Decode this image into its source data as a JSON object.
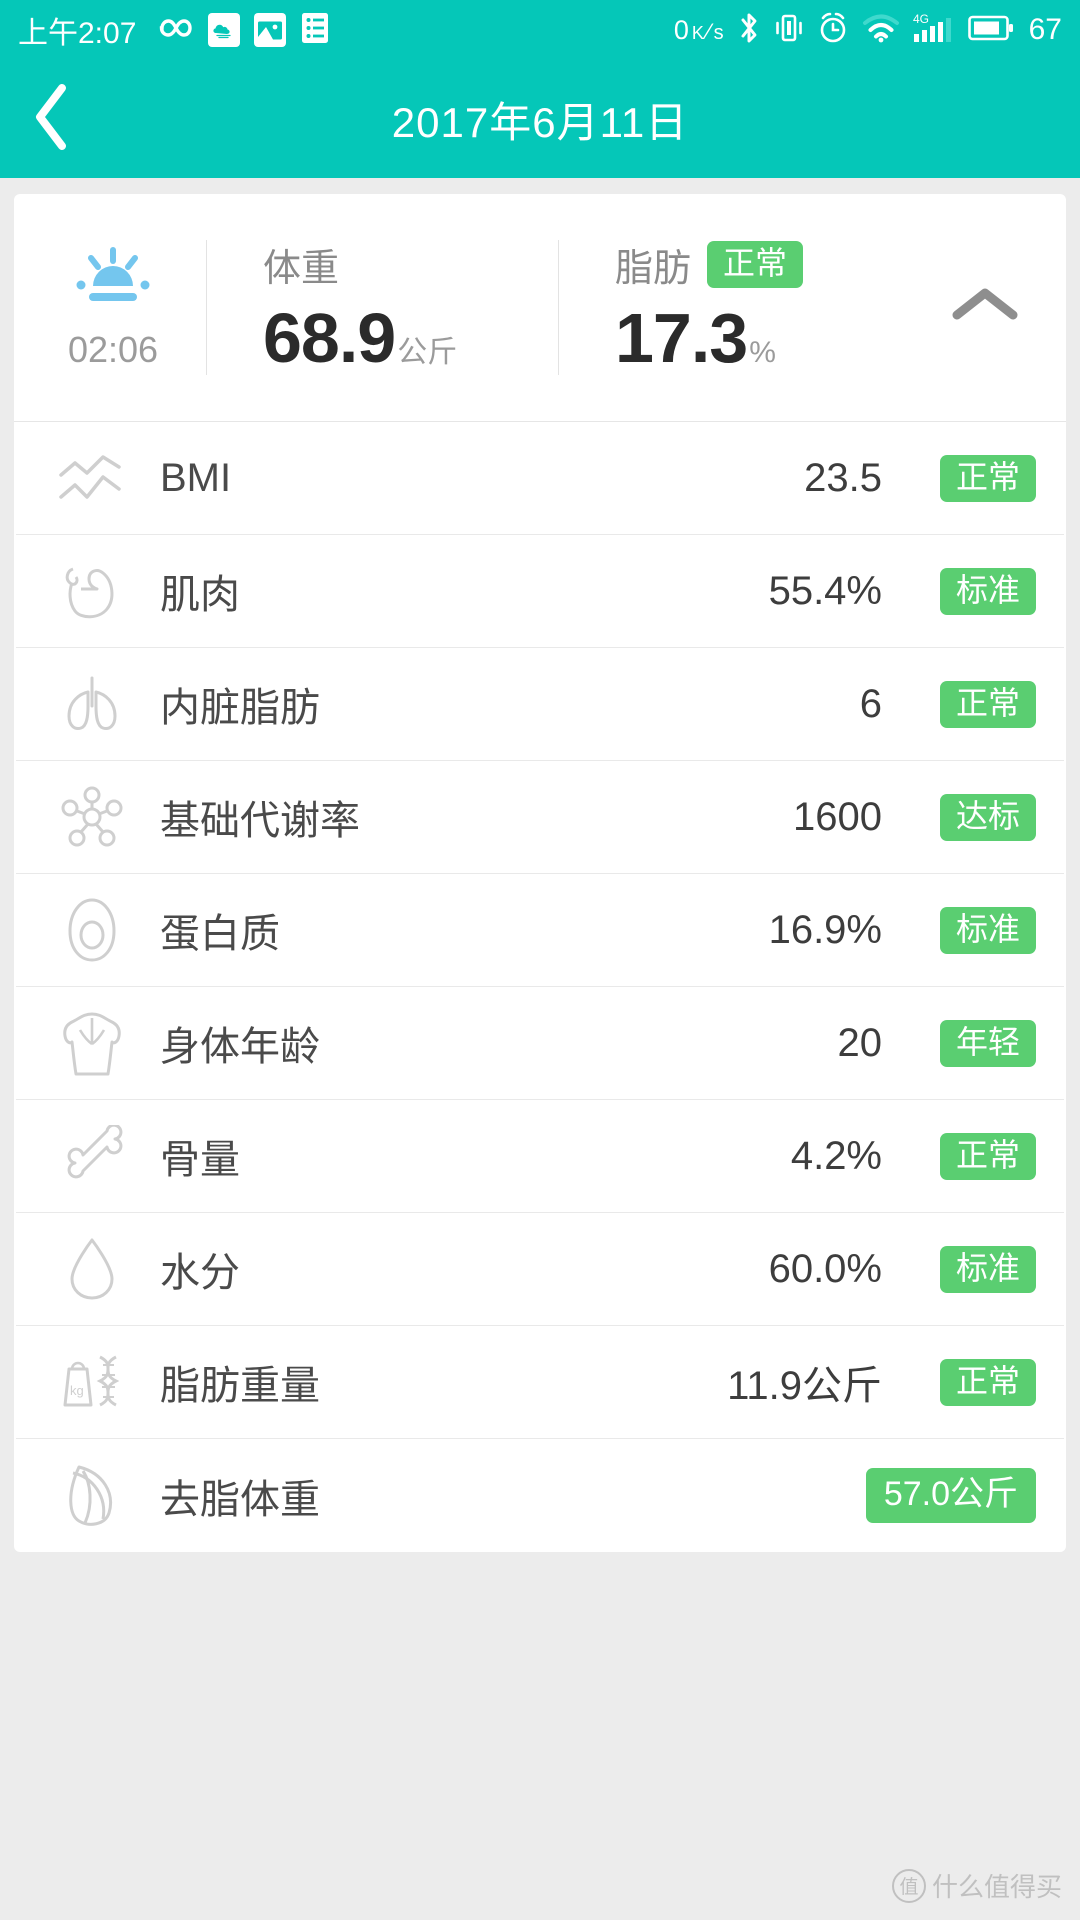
{
  "statusbar": {
    "clock": "上午2:07",
    "net_speed_value": "0",
    "net_speed_unit_top": "K",
    "net_speed_unit_bottom": "s",
    "battery_percent": "67",
    "signal_type": "4G",
    "icons": [
      "infinity-icon",
      "cloud-app-icon",
      "gallery-icon",
      "list-icon",
      "bluetooth-icon",
      "vibrate-icon",
      "alarm-icon",
      "wifi-icon",
      "cellular-signal-icon",
      "battery-icon"
    ]
  },
  "titlebar": {
    "back_icon": "chevron-left-icon",
    "title": "2017年6月11日"
  },
  "summary": {
    "time_icon": "sunrise-icon",
    "time": "02:06",
    "weight": {
      "label": "体重",
      "value": "68.9",
      "unit": "公斤"
    },
    "fat": {
      "label": "脂肪",
      "badge": "正常",
      "value": "17.3",
      "unit": "%"
    },
    "collapse_icon": "chevron-up-icon"
  },
  "metrics": [
    {
      "icon": "trend-line-icon",
      "label": "BMI",
      "value": "23.5",
      "badge": "正常",
      "badge_only": false
    },
    {
      "icon": "muscle-arm-icon",
      "label": "肌肉",
      "value": "55.4%",
      "badge": "标准",
      "badge_only": false
    },
    {
      "icon": "lungs-icon",
      "label": "内脏脂肪",
      "value": "6",
      "badge": "正常",
      "badge_only": false
    },
    {
      "icon": "molecule-icon",
      "label": "基础代谢率",
      "value": "1600",
      "badge": "达标",
      "badge_only": false
    },
    {
      "icon": "avocado-icon",
      "label": "蛋白质",
      "value": "16.9%",
      "badge": "标准",
      "badge_only": false
    },
    {
      "icon": "torso-icon",
      "label": "身体年龄",
      "value": "20",
      "badge": "年轻",
      "badge_only": false
    },
    {
      "icon": "bone-icon",
      "label": "骨量",
      "value": "4.2%",
      "badge": "正常",
      "badge_only": false
    },
    {
      "icon": "water-drop-icon",
      "label": "水分",
      "value": "60.0%",
      "badge": "标准",
      "badge_only": false
    },
    {
      "icon": "weight-dna-icon",
      "label": "脂肪重量",
      "value": "11.9公斤",
      "badge": "正常",
      "badge_only": false
    },
    {
      "icon": "leaf-icon",
      "label": "去脂体重",
      "value": "",
      "badge": "57.0公斤",
      "badge_only": true
    }
  ],
  "watermark": {
    "mark": "值",
    "text": "什么值得买"
  },
  "colors": {
    "teal": "#05c7b8",
    "badge_green": "#5ace71",
    "page_bg": "#ececec",
    "sunrise_blue": "#74c6ee"
  }
}
